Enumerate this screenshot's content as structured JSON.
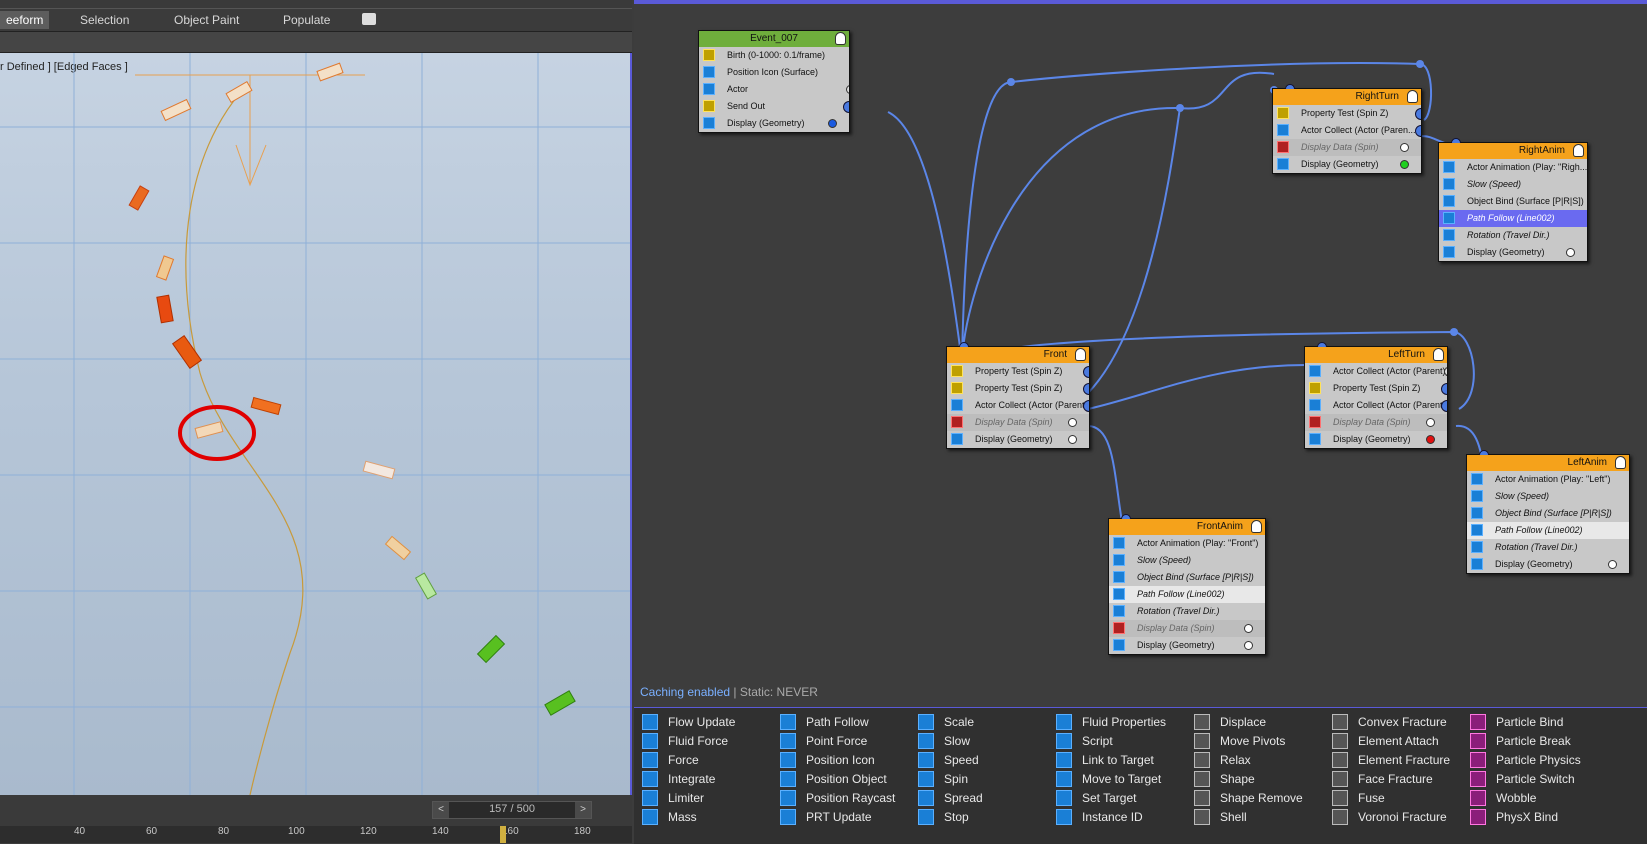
{
  "viewport": {
    "ribbon_tabs": [
      "eeform",
      "Selection",
      "Object Paint",
      "Populate"
    ],
    "label": "r Defined ] [Edged Faces ]",
    "frame_display": "157 / 500",
    "ruler_ticks": [
      "40",
      "60",
      "80",
      "100",
      "120",
      "140",
      "160",
      "180"
    ]
  },
  "graph": {
    "status_enabled": "Caching enabled",
    "status_rest": " | Static: NEVER",
    "nodes": {
      "event": {
        "title": "Event_007",
        "ops": [
          "Birth (0-1000: 0.1/frame)",
          "Position Icon (Surface)",
          "Actor",
          "Send Out",
          "Display (Geometry)"
        ]
      },
      "rightturn": {
        "title": "RightTurn",
        "ops": [
          "Property Test (Spin Z)",
          "Actor Collect (Actor (Paren...",
          "Display Data (Spin)",
          "Display (Geometry)"
        ]
      },
      "rightanim": {
        "title": "RightAnim",
        "ops": [
          "Actor Animation (Play: \"Righ...",
          "Slow (Speed)",
          "Object Bind (Surface [P|R|S])",
          "Path Follow (Line002)",
          "Rotation (Travel Dir.)",
          "Display (Geometry)"
        ]
      },
      "front": {
        "title": "Front",
        "ops": [
          "Property Test (Spin Z)",
          "Property Test (Spin Z)",
          "Actor Collect (Actor (Parent))",
          "Display Data (Spin)",
          "Display (Geometry)"
        ]
      },
      "leftturn": {
        "title": "LeftTurn",
        "ops": [
          "Actor Collect (Actor (Parent))",
          "Property Test (Spin Z)",
          "Actor Collect (Actor (Parent))",
          "Display Data (Spin)",
          "Display (Geometry)"
        ]
      },
      "leftanim": {
        "title": "LeftAnim",
        "ops": [
          "Actor Animation (Play: \"Left\")",
          "Slow (Speed)",
          "Object Bind (Surface [P|R|S])",
          "Path Follow (Line002)",
          "Rotation (Travel Dir.)",
          "Display (Geometry)"
        ]
      },
      "frontanim": {
        "title": "FrontAnim",
        "ops": [
          "Actor Animation (Play: \"Front\")",
          "Slow (Speed)",
          "Object Bind (Surface [P|R|S])",
          "Path Follow (Line002)",
          "Rotation (Travel Dir.)",
          "Display Data (Spin)",
          "Display (Geometry)"
        ]
      }
    }
  },
  "depot": {
    "columns": [
      [
        "Flow Update",
        "Fluid Force",
        "Force",
        "Integrate",
        "Limiter",
        "Mass"
      ],
      [
        "Path Follow",
        "Point Force",
        "Position Icon",
        "Position Object",
        "Position Raycast",
        "PRT Update"
      ],
      [
        "Scale",
        "Slow",
        "Speed",
        "Spin",
        "Spread",
        "Stop"
      ],
      [
        "Fluid Properties",
        "Script",
        "Link to Target",
        "Move to Target",
        "Set Target",
        "Instance ID"
      ],
      [
        "Displace",
        "Move Pivots",
        "Relax",
        "Shape",
        "Shape Remove",
        "Shell"
      ],
      [
        "Convex Fracture",
        "Element Attach",
        "Element Fracture",
        "Face Fracture",
        "Fuse",
        "Voronoi Fracture"
      ],
      [
        "Particle Bind",
        "Particle Break",
        "Particle Physics",
        "Particle Switch",
        "Wobble",
        "PhysX Bind"
      ]
    ],
    "colors": {
      "col0": "blue",
      "col1": "blue",
      "col2": "blue",
      "col3": "blue",
      "col4": "gray",
      "col5": "gray",
      "col6": "pink"
    }
  }
}
